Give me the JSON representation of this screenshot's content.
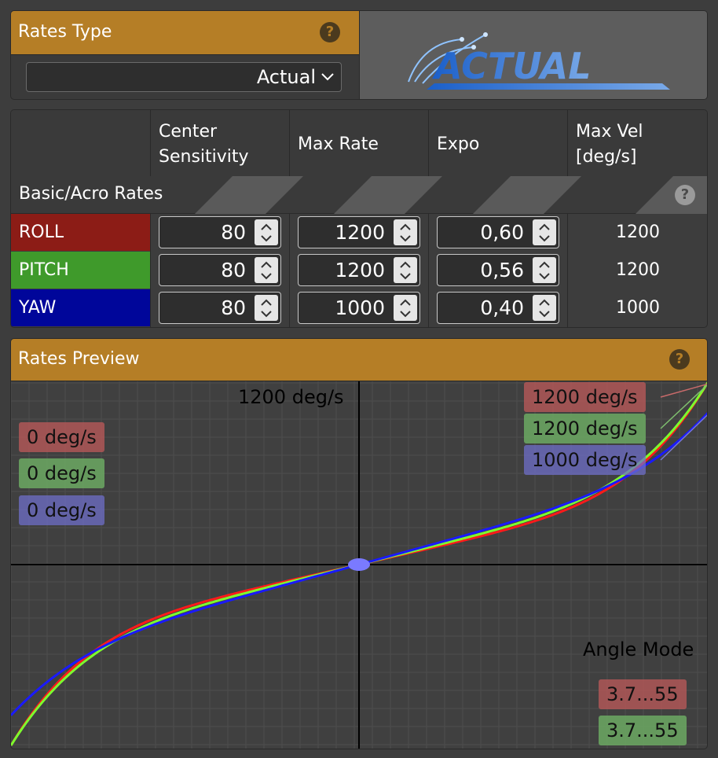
{
  "rates_type": {
    "title": "Rates Type",
    "selected": "Actual",
    "logo_text": "ACTUAL"
  },
  "table": {
    "headers": [
      "Center\nSensitivity",
      "Max Rate",
      "Expo",
      "Max Vel\n[deg/s]"
    ],
    "section_title": "Basic/Acro Rates",
    "rows": [
      {
        "axis": "ROLL",
        "center": "80",
        "max_rate": "1200",
        "expo": "0,60",
        "max_vel": "1200",
        "color": "#8c1c16"
      },
      {
        "axis": "PITCH",
        "center": "80",
        "max_rate": "1200",
        "expo": "0,56",
        "max_vel": "1200",
        "color": "#3f9a2b"
      },
      {
        "axis": "YAW",
        "center": "80",
        "max_rate": "1000",
        "expo": "0,40",
        "max_vel": "1000",
        "color": "#00069a"
      }
    ]
  },
  "preview": {
    "title": "Rates Preview",
    "top_center_label": "1200 deg/s",
    "current_rates": [
      "0 deg/s",
      "0 deg/s",
      "0 deg/s"
    ],
    "max_rates": [
      "1200 deg/s",
      "1200 deg/s",
      "1000 deg/s"
    ],
    "angle_mode_label": "Angle Mode",
    "angle_mode_values": [
      "3.7...55",
      "3.7...55"
    ],
    "line_colors": {
      "roll": "#ff1a1a",
      "pitch": "#7dff2e",
      "yaw": "#1a1aff"
    }
  },
  "icons": {
    "help": "help-icon",
    "chevron": "chevron-down-icon"
  }
}
